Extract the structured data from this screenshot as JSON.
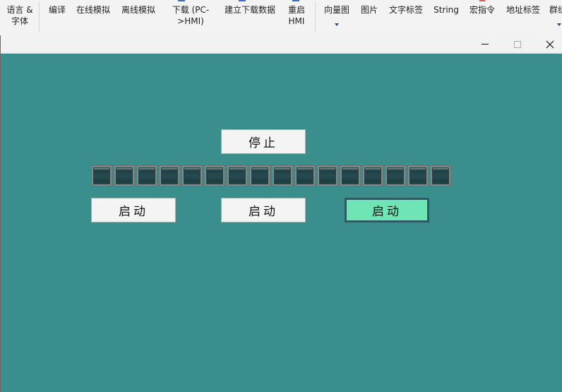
{
  "ribbon": {
    "items": [
      {
        "line1": "语言 &",
        "line2": "字体"
      },
      {
        "line1": "编译",
        "line2": ""
      },
      {
        "line1": "在线模拟",
        "line2": ""
      },
      {
        "line1": "离线模拟",
        "line2": ""
      },
      {
        "line1": "下载 (PC-",
        "line2": ">HMI)"
      },
      {
        "line1": "建立下载数据",
        "line2": ""
      },
      {
        "line1": "重启",
        "line2": "HMI"
      },
      {
        "line1": "向量图",
        "line2": ""
      },
      {
        "line1": "图片",
        "line2": ""
      },
      {
        "line1": "文字标签",
        "line2": ""
      },
      {
        "line1": "String",
        "line2": ""
      },
      {
        "line1": "宏指令",
        "line2": ""
      },
      {
        "line1": "地址标签",
        "line2": ""
      },
      {
        "line1": "群组",
        "line2": ""
      }
    ]
  },
  "window": {
    "minimize_icon": "minimize-icon",
    "maximize_icon": "maximize-icon",
    "close_icon": "close-icon"
  },
  "hmi": {
    "background_color": "#3a8f8d",
    "stop_button": {
      "label": "停止"
    },
    "lamps": {
      "count": 16,
      "states": [
        "off",
        "off",
        "off",
        "off",
        "off",
        "off",
        "off",
        "off",
        "off",
        "off",
        "off",
        "off",
        "off",
        "off",
        "off",
        "off"
      ]
    },
    "start_buttons": [
      {
        "label": "启动",
        "active": false
      },
      {
        "label": "启动",
        "active": false
      },
      {
        "label": "启动",
        "active": true
      }
    ],
    "active_color": "#6fe4b4"
  }
}
